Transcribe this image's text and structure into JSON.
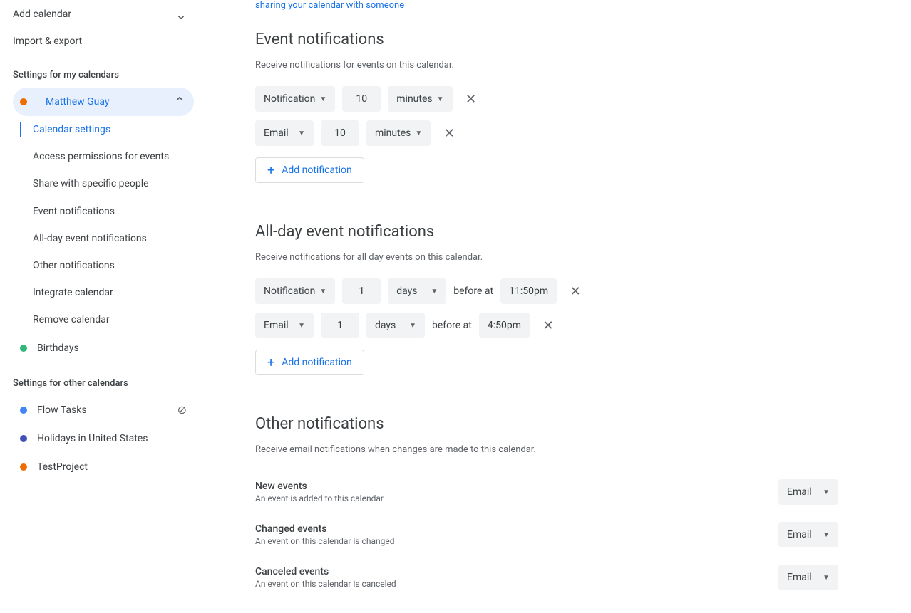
{
  "sidebar": {
    "add_calendar": "Add calendar",
    "import_export": "Import & export",
    "section_my": "Settings for my calendars",
    "primary_calendar": "Matthew Guay",
    "subnav": [
      "Calendar settings",
      "Access permissions for events",
      "Share with specific people",
      "Event notifications",
      "All-day event notifications",
      "Other notifications",
      "Integrate calendar",
      "Remove calendar"
    ],
    "birthdays": "Birthdays",
    "section_other": "Settings for other calendars",
    "other_calendars": [
      {
        "name": "Flow Tasks",
        "color": "#4285f4"
      },
      {
        "name": "Holidays in United States",
        "color": "#3f51b5"
      },
      {
        "name": "TestProject",
        "color": "#ef6c00"
      }
    ],
    "primary_color": "#ef6c00",
    "birthdays_color": "#33b679"
  },
  "top_link": "sharing your calendar with someone",
  "sections": {
    "event": {
      "title": "Event notifications",
      "subtitle": "Receive notifications for events on this calendar.",
      "rows": [
        {
          "method": "Notification",
          "value": "10",
          "unit": "minutes"
        },
        {
          "method": "Email",
          "value": "10",
          "unit": "minutes"
        }
      ],
      "add_label": "Add notification"
    },
    "allday": {
      "title": "All-day event notifications",
      "subtitle": "Receive notifications for all day events on this calendar.",
      "before_at": "before at",
      "rows": [
        {
          "method": "Notification",
          "value": "1",
          "unit": "days",
          "time": "11:50pm"
        },
        {
          "method": "Email",
          "value": "1",
          "unit": "days",
          "time": "4:50pm"
        }
      ],
      "add_label": "Add notification"
    },
    "other": {
      "title": "Other notifications",
      "subtitle": "Receive email notifications when changes are made to this calendar.",
      "rows": [
        {
          "title": "New events",
          "desc": "An event is added to this calendar",
          "value": "Email"
        },
        {
          "title": "Changed events",
          "desc": "An event on this calendar is changed",
          "value": "Email"
        },
        {
          "title": "Canceled events",
          "desc": "An event on this calendar is canceled",
          "value": "Email"
        }
      ]
    }
  }
}
